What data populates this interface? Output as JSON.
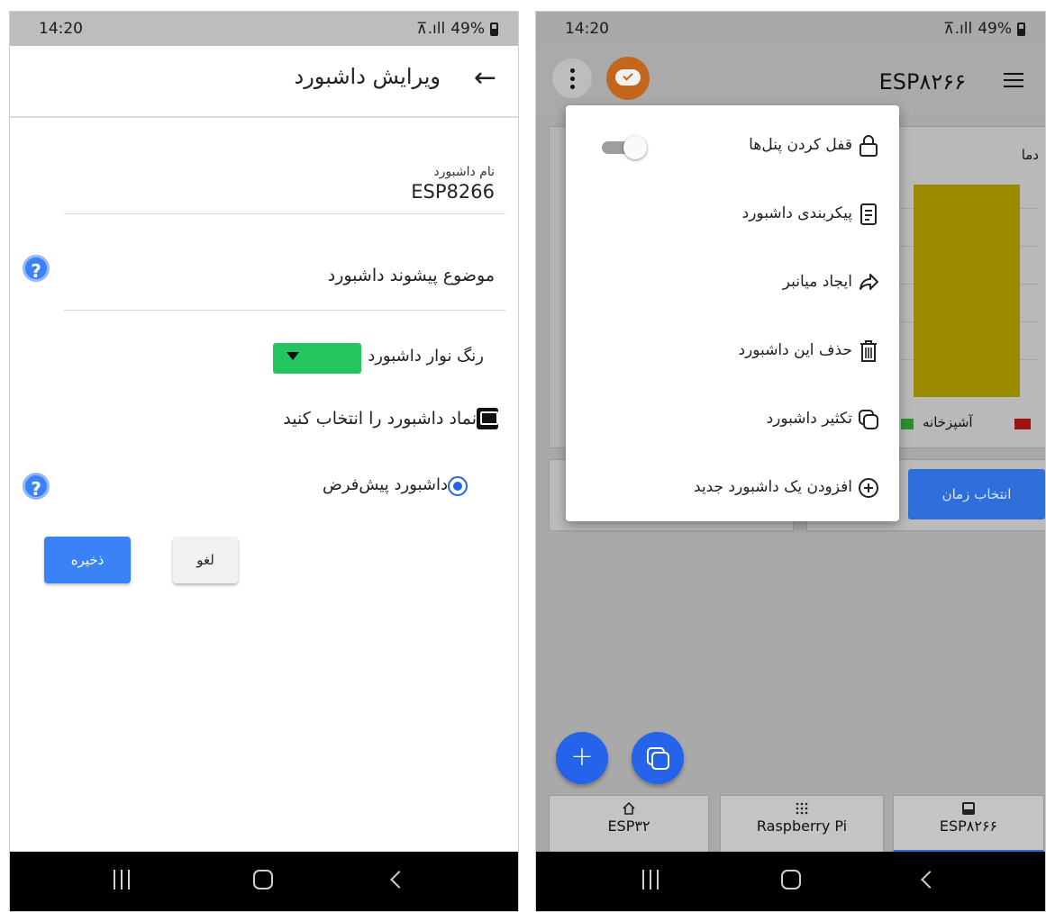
{
  "left": {
    "status": {
      "time": "14:20",
      "signal": "⊼.ıll",
      "battery": "49%"
    },
    "appbar": {
      "title": "ویرایش داشبورد",
      "back_icon": "arrow-back-icon"
    },
    "form": {
      "name_label": "نام داشبورد",
      "name_value": "ESP8266",
      "topic_prefix_label": "موضوع پیشوند داشبورد",
      "bar_color_label": "رنگ نوار داشبورد",
      "bar_color_value": "#22c55e",
      "symbol_label": "نماد داشبورد را انتخاب کنید",
      "default_label": "داشبورد پیش‌فرض"
    },
    "buttons": {
      "save": "ذخیره",
      "cancel": "لغو"
    }
  },
  "right": {
    "status": {
      "time": "14:20",
      "signal": "⊼.ıll",
      "battery": "49%"
    },
    "appbar": {
      "title": "ESP۸۲۶۶"
    },
    "menu": {
      "items": [
        {
          "label": "قفل کردن پنل‌ها",
          "icon": "lock-icon"
        },
        {
          "label": "پیکربندی داشبورد",
          "icon": "document-icon"
        },
        {
          "label": "ایجاد میانبر",
          "icon": "share-icon"
        },
        {
          "label": "حذف این داشبورد",
          "icon": "trash-icon"
        },
        {
          "label": "تکثیر داشبورد",
          "icon": "copy-icon"
        },
        {
          "label": "افزودن یک داشبورد جدید",
          "icon": "add-circle-icon"
        }
      ]
    },
    "chart_panel": {
      "title": "دما",
      "legend_label": "آشپزخانه"
    },
    "time_button": "انتخاب زمان",
    "tabs": [
      {
        "label": "ESP۳۲",
        "icon": "home-icon"
      },
      {
        "label": "Raspberry Pi",
        "icon": "grid-icon"
      },
      {
        "label": "ESP۸۲۶۶",
        "icon": "monitor-icon"
      }
    ],
    "fab_add": "+"
  }
}
